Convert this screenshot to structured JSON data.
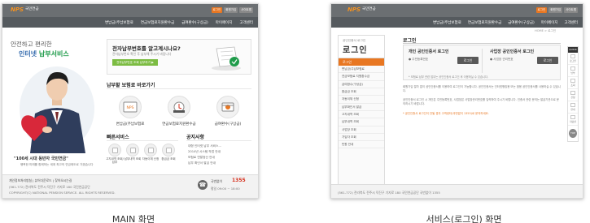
{
  "captions": {
    "main": "MAIN 화면",
    "service": "서비스(로그인) 화면"
  },
  "colors": {
    "brand_orange": "#e87722",
    "brand_green": "#7cbc42",
    "topbar": "#6b6f72",
    "nav": "#555a5e"
  },
  "main": {
    "logo": {
      "mark": "NPS",
      "org": "국민연금"
    },
    "util": [
      "로그인",
      "회원가입",
      "사이트맵"
    ],
    "nav": [
      "변납금(주납보험료",
      "연금보험료지원환수금",
      "급여환수(구상금)",
      "마이페이지",
      "고객센터"
    ],
    "hero": {
      "line1": "안전하고 편리한",
      "line2_a": "인터넷 ",
      "line2_b": "납부서비스",
      "quote": "\"100세 시대 동반자 국민연금\"",
      "sub": "행복한 미래를 함께하는 세계 최고의 연금제도로 가겠습니다"
    },
    "question": {
      "title": "전자납부번호를 알고계시나요?",
      "desc": "전자납부번호 확인 후 납부해 주시기 바랍니다",
      "button": "전자납부번호 조회 납부하기 ▶"
    },
    "quick_pay": {
      "title": "납부할 보험료 바로가기",
      "items": [
        "변납금(주납보험료",
        "연금보험료지원환수금",
        "급여환수(구상금)"
      ]
    },
    "fast_service": {
      "title": "빠른서비스",
      "items": [
        "고지내역 조회/납부",
        "납부내역 조회",
        "자동이체 신청",
        "환급금 조회"
      ]
    },
    "notice": {
      "title": "공지사항",
      "items": [
        "대형 인터넷 납부 서비스...",
        "2014년 시스템 작업 안내",
        "보험료 연말정산 안내",
        "납부 확인서 발급 안내"
      ]
    },
    "footer": {
      "links": [
        "개인정보처리방침",
        "뷰어다운로드",
        "찾아오시는길"
      ],
      "addr": "(561-772) 전라북도 전주시 덕진구 기지로 180 국민연금공단",
      "copyright": "COPYRIGHT(C) NATIONAL PENSION SERVICE. ALL RIGHTS RESERVED.",
      "call_label": "국번없이",
      "call_number": "1355",
      "hours": "평일 09:00 ~ 18:00"
    }
  },
  "service": {
    "logo": {
      "mark": "NPS",
      "org": "국민연금"
    },
    "util": [
      "로그인",
      "회원가입",
      "사이트맵"
    ],
    "nav": [
      "변납금(주납보험료",
      "연금보험료지원환수금",
      "급여환수(구상금)",
      "마이페이지",
      "고객센터"
    ],
    "crumb": "HOME > 로그인",
    "side": {
      "small": "공인인증서 로그인",
      "big": "로그인",
      "active": "로그인",
      "items": [
        "변납금(주납보험료",
        "연금보험료 지원환수금",
        "급여환수(구상금)",
        "환급금 조회",
        "자동이체 신청",
        "납부확인서 발급",
        "고지내역 조회",
        "납부내역 조회",
        "사업장 조회",
        "가입자 조회",
        "민원 안내"
      ]
    },
    "page_title": "로그인",
    "login": {
      "personal": {
        "title": "개인 공인인증서 로그인",
        "radio": "● 주민등록번호",
        "button": "로그인"
      },
      "business": {
        "title": "사업장 공인인증서 로그인",
        "radio": "● 사업장 관리번호",
        "button": "로그인"
      },
      "note": "* 보험료 납부 관련 업무는 공인인증서 로그인 후 이용하실 수 있습니다."
    },
    "para1": "회원가입 절차 없이 공인인증서를 이용하여 로그인이 가능합니다. 공인인증서는 인터넷뱅킹용 또는 범용 공인인증서를 사용하실 수 있습니다.",
    "para2": "공인인증서 로그인 시 개인은 주민등록번호, 사업장은 사업장관리번호를 입력하여 주시기 바랍니다. 인증서 관련 문의는 발급기관으로 문의하시기 바랍니다.",
    "para_emph": "* 공인인증서 로그인이 안될 경우 고객센터(국번없이 1355)로 문의하세요.",
    "quick": {
      "title": "QUICK",
      "items": [
        "로그인",
        "납부",
        "조회",
        "신청",
        "안내",
        "자료실"
      ],
      "top": "TOP"
    },
    "footer": "(561-772) 전라북도 전주시 덕진구 기지로 180 국민연금공단 국번없이 1355"
  }
}
